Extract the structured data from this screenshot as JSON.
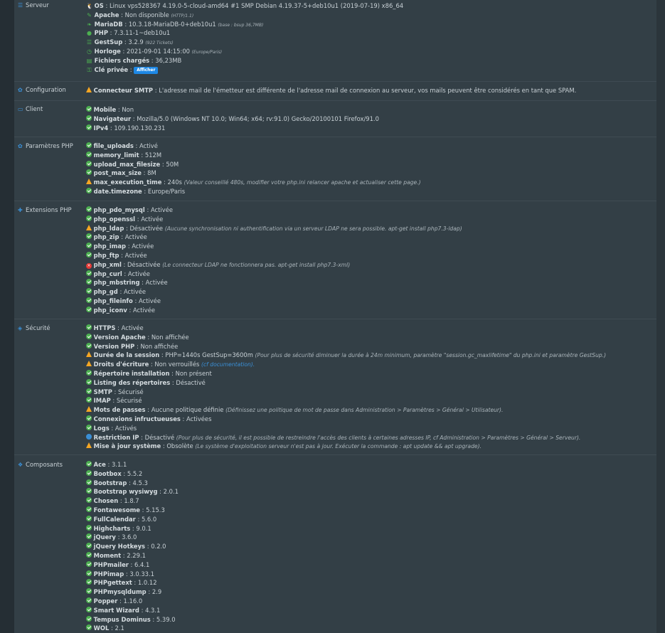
{
  "colors": {
    "background": "#333f46",
    "accent": "#3a8fd6",
    "ok": "#4caf50",
    "warning": "#f5a623",
    "error": "#e53935"
  },
  "serveur": {
    "title": "Serveur",
    "rows": [
      {
        "icon": "linux-icon",
        "key": "OS",
        "sep": " : ",
        "val": "Linux vps528367 4.19.0-5-cloud-amd64 #1 SMP Debian 4.19.37-5+deb10u1 (2019-07-19) x86_64",
        "note": ""
      },
      {
        "icon": "feather-icon",
        "key": "Apache",
        "sep": " : ",
        "val": "Non disponible ",
        "note": "(HTTP/1.1)"
      },
      {
        "icon": "leaf-icon",
        "key": "MariaDB",
        "sep": " : ",
        "val": "10.3.18-MariaDB-0+deb10u1 ",
        "note": "(base : bsup 36,7MB)"
      },
      {
        "icon": "php-icon",
        "key": "PHP",
        "sep": " : ",
        "val": "7.3.11-1~deb10u1",
        "note": ""
      },
      {
        "icon": "list-icon",
        "key": "GestSup",
        "sep": " : ",
        "val": "3.2.9 ",
        "note": "(922 Tickets)"
      },
      {
        "icon": "clock-icon",
        "key": "Horloge",
        "sep": " : ",
        "val": "2021-09-01 14:15:00 ",
        "note": "(Europe/Paris)"
      },
      {
        "icon": "hdd-icon",
        "key": "Fichiers chargés",
        "sep": " : ",
        "val": "36,23MB",
        "note": ""
      },
      {
        "icon": "key-icon",
        "key": "Clé privée",
        "sep": " : ",
        "val": "",
        "note": ""
      }
    ],
    "show_button": "Afficher"
  },
  "configuration": {
    "title": "Configuration",
    "rows": [
      {
        "status": "warn",
        "key": "Connecteur SMTP",
        "sep": " : ",
        "val": "L'adresse mail de l'émetteur est différente de l'adresse mail de connexion au serveur, vos mails peuvent être considérés en tant que SPAM.",
        "note": ""
      }
    ]
  },
  "client": {
    "title": "Client",
    "rows": [
      {
        "status": "ok",
        "key": "Mobile",
        "sep": " : ",
        "val": "Non",
        "note": ""
      },
      {
        "status": "ok",
        "key": "Navigateur",
        "sep": " : ",
        "val": "Mozilla/5.0 (Windows NT 10.0; Win64; x64; rv:91.0) Gecko/20100101 Firefox/91.0",
        "note": ""
      },
      {
        "status": "ok",
        "key": "IPv4",
        "sep": " : ",
        "val": "109.190.130.231",
        "note": ""
      }
    ]
  },
  "php_params": {
    "title": "Paramètres PHP",
    "rows": [
      {
        "status": "ok",
        "key": "file_uploads",
        "sep": " : ",
        "val": "Activé",
        "note": ""
      },
      {
        "status": "ok",
        "key": "memory_limit",
        "sep": " : ",
        "val": "512M",
        "note": ""
      },
      {
        "status": "ok",
        "key": "upload_max_filesize",
        "sep": " : ",
        "val": "50M",
        "note": ""
      },
      {
        "status": "ok",
        "key": "post_max_size",
        "sep": " : ",
        "val": "8M",
        "note": ""
      },
      {
        "status": "warn",
        "key": "max_execution_time",
        "sep": " : ",
        "val": "240s ",
        "note": "(Valeur conseillé 480s, modifier votre php.ini relancer apache et actualiser cette page.)"
      },
      {
        "status": "ok",
        "key": "date.timezone",
        "sep": " : ",
        "val": "Europe/Paris",
        "note": ""
      }
    ]
  },
  "extensions": {
    "title": "Extensions PHP",
    "rows": [
      {
        "status": "ok",
        "key": "php_pdo_mysql",
        "sep": " : ",
        "val": "Activée",
        "note": ""
      },
      {
        "status": "ok",
        "key": "php_openssl",
        "sep": " : ",
        "val": "Activée",
        "note": ""
      },
      {
        "status": "warn",
        "key": "php_ldap",
        "sep": " : ",
        "val": "Désactivée ",
        "note": "(Aucune synchronisation ni authentification via un serveur LDAP ne sera possible. apt-get install php7.3-ldap)"
      },
      {
        "status": "ok",
        "key": "php_zip",
        "sep": " : ",
        "val": "Activée",
        "note": ""
      },
      {
        "status": "ok",
        "key": "php_imap",
        "sep": " : ",
        "val": "Activée",
        "note": ""
      },
      {
        "status": "ok",
        "key": "php_ftp",
        "sep": " : ",
        "val": "Activée",
        "note": ""
      },
      {
        "status": "err",
        "key": "php_xml",
        "sep": " : ",
        "val": "Désactivée ",
        "note": "(Le connecteur LDAP ne fonctionnera pas. apt-get install php7.3-xml)"
      },
      {
        "status": "ok",
        "key": "php_curl",
        "sep": " : ",
        "val": "Activée",
        "note": ""
      },
      {
        "status": "ok",
        "key": "php_mbstring",
        "sep": " : ",
        "val": "Activée",
        "note": ""
      },
      {
        "status": "ok",
        "key": "php_gd",
        "sep": " : ",
        "val": "Activée",
        "note": ""
      },
      {
        "status": "ok",
        "key": "php_fileinfo",
        "sep": " : ",
        "val": "Activée",
        "note": ""
      },
      {
        "status": "ok",
        "key": "php_iconv",
        "sep": " : ",
        "val": "Activée",
        "note": ""
      }
    ]
  },
  "securite": {
    "title": "Sécurité",
    "rows": [
      {
        "status": "ok",
        "key": "HTTPS",
        "sep": " : ",
        "val": "Activée",
        "note": ""
      },
      {
        "status": "ok",
        "key": "Version Apache",
        "sep": " : ",
        "val": "Non affichée",
        "note": ""
      },
      {
        "status": "ok",
        "key": "Version PHP",
        "sep": " : ",
        "val": "Non affichée",
        "note": ""
      },
      {
        "status": "warn",
        "key": "Durée de la session",
        "sep": " : ",
        "val": "PHP=1440s GestSup=3600m ",
        "note": "(Pour plus de sécurité diminuer la durée à 24m minimum, paramètre \"session.gc_maxlifetime\" du php.ini et paramètre GestSup.)"
      },
      {
        "status": "warn",
        "key": "Droits d'écriture",
        "sep": " : ",
        "val": "Non verrouillés ",
        "note": "(cf documentation)."
      },
      {
        "status": "ok",
        "key": "Répertoire installation",
        "sep": " : ",
        "val": "Non présent",
        "note": ""
      },
      {
        "status": "ok",
        "key": "Listing des répertoires",
        "sep": " : ",
        "val": "Désactivé",
        "note": ""
      },
      {
        "status": "ok",
        "key": "SMTP",
        "sep": " : ",
        "val": "Sécurisé",
        "note": ""
      },
      {
        "status": "ok",
        "key": "IMAP",
        "sep": " : ",
        "val": "Sécurisé",
        "note": ""
      },
      {
        "status": "warn",
        "key": "Mots de passes",
        "sep": " : ",
        "val": "Aucune politique définie ",
        "note": "(Définissez une politique de mot de passe dans Administration > Paramètres > Général > Utilisateur)."
      },
      {
        "status": "ok",
        "key": "Connexions infructueuses",
        "sep": " : ",
        "val": "Activées",
        "note": ""
      },
      {
        "status": "ok",
        "key": "Logs",
        "sep": " : ",
        "val": "Activés",
        "note": ""
      },
      {
        "status": "info",
        "key": "Restriction IP",
        "sep": " : ",
        "val": "Désactivé ",
        "note": "(Pour plus de sécurité, il est possible de restreindre l'accès des clients à certaines adresses IP, cf Administration > Paramètres > Général > Serveur)."
      },
      {
        "status": "warn",
        "key": "Mise à jour système",
        "sep": " : ",
        "val": "Obsolète ",
        "note": "(Le système d'exploitation serveur n'est pas à jour. Exécuter la commande : apt update && apt upgrade)."
      }
    ]
  },
  "composants": {
    "title": "Composants",
    "rows": [
      {
        "status": "ok",
        "key": "Ace",
        "sep": " : ",
        "val": "3.1.1",
        "note": ""
      },
      {
        "status": "ok",
        "key": "Bootbox",
        "sep": " : ",
        "val": "5.5.2",
        "note": ""
      },
      {
        "status": "ok",
        "key": "Bootstrap",
        "sep": " : ",
        "val": "4.5.3",
        "note": ""
      },
      {
        "status": "ok",
        "key": "Bootstrap wysiwyg",
        "sep": " : ",
        "val": "2.0.1",
        "note": ""
      },
      {
        "status": "ok",
        "key": "Chosen",
        "sep": " : ",
        "val": "1.8.7",
        "note": ""
      },
      {
        "status": "ok",
        "key": "Fontawesome",
        "sep": " : ",
        "val": "5.15.3",
        "note": ""
      },
      {
        "status": "ok",
        "key": "FullCalendar",
        "sep": " : ",
        "val": "5.6.0",
        "note": ""
      },
      {
        "status": "ok",
        "key": "Highcharts",
        "sep": " : ",
        "val": "9.0.1",
        "note": ""
      },
      {
        "status": "ok",
        "key": "jQuery",
        "sep": " : ",
        "val": "3.6.0",
        "note": ""
      },
      {
        "status": "ok",
        "key": "jQuery Hotkeys",
        "sep": " : ",
        "val": "0.2.0",
        "note": ""
      },
      {
        "status": "ok",
        "key": "Moment",
        "sep": " : ",
        "val": "2.29.1",
        "note": ""
      },
      {
        "status": "ok",
        "key": "PHPmailer",
        "sep": " : ",
        "val": "6.4.1",
        "note": ""
      },
      {
        "status": "ok",
        "key": "PHPimap",
        "sep": " : ",
        "val": "3.0.33.1",
        "note": ""
      },
      {
        "status": "ok",
        "key": "PHPgettext",
        "sep": " : ",
        "val": "1.0.12",
        "note": ""
      },
      {
        "status": "ok",
        "key": "PHPmysqldump",
        "sep": " : ",
        "val": "2.9",
        "note": ""
      },
      {
        "status": "ok",
        "key": "Popper",
        "sep": " : ",
        "val": "1.16.0",
        "note": ""
      },
      {
        "status": "ok",
        "key": "Smart Wizard",
        "sep": " : ",
        "val": "4.3.1",
        "note": ""
      },
      {
        "status": "ok",
        "key": "Tempus Dominus",
        "sep": " : ",
        "val": "5.39.0",
        "note": ""
      },
      {
        "status": "ok",
        "key": "WOL",
        "sep": " : ",
        "val": "2.1",
        "note": ""
      }
    ]
  }
}
